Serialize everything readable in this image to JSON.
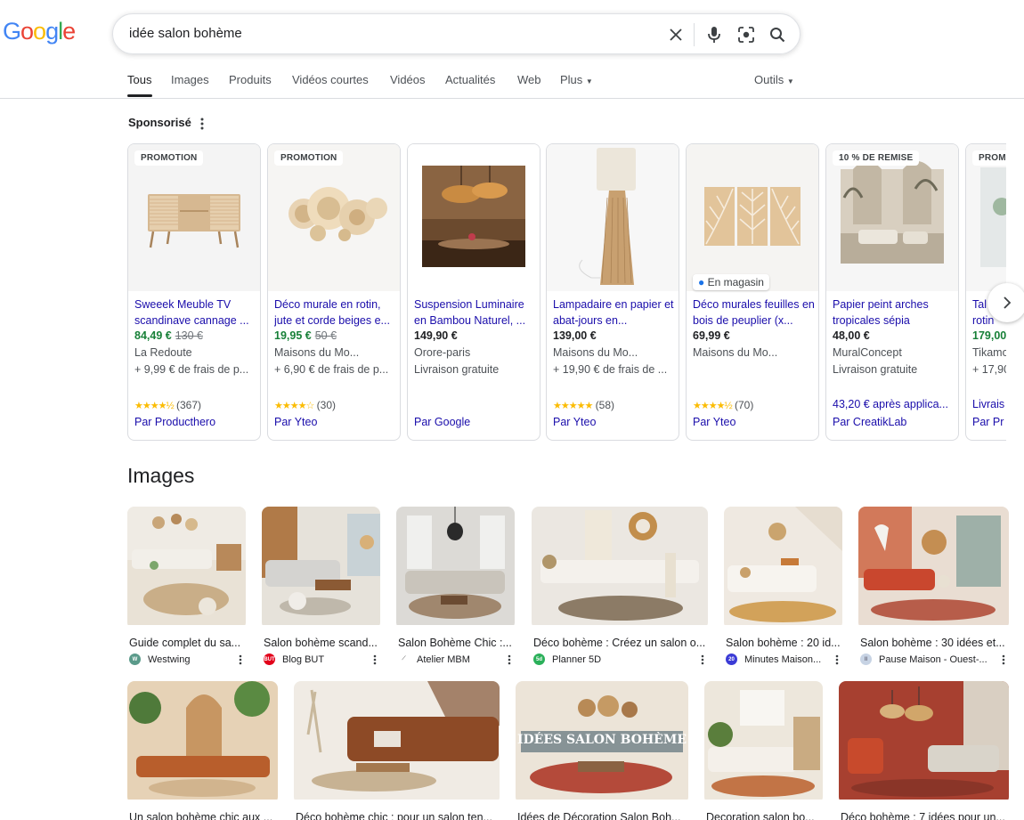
{
  "search": {
    "query": "idée salon bohème",
    "clear_label": "×"
  },
  "logo": {
    "letters": [
      "G",
      "o",
      "o",
      "g",
      "l",
      "e"
    ],
    "colors": [
      "#4285f4",
      "#ea4335",
      "#fbbc05",
      "#4285f4",
      "#34a853",
      "#ea4335"
    ]
  },
  "tabs": [
    "Tous",
    "Images",
    "Produits",
    "Vidéos courtes",
    "Vidéos",
    "Actualités",
    "Web",
    "Plus",
    "Outils"
  ],
  "sponsored": {
    "label": "Sponsorisé"
  },
  "cards": [
    {
      "badge": "PROMOTION",
      "title": "Sweeek Meuble TV scandinave cannage ...",
      "price": "84,49 €",
      "old_price": "130 €",
      "store": "La Redoute",
      "shipping": "+ 9,99 € de frais de p...",
      "rating": "(367)",
      "stars": "★★★★½",
      "by": "Par Producthero"
    },
    {
      "badge": "PROMOTION",
      "title": "Déco murale en rotin, jute et corde beiges e...",
      "price": "19,95 €",
      "old_price": "50 €",
      "store": "Maisons du Mo...",
      "shipping": "+ 6,90 € de frais de p...",
      "rating": "(30)",
      "stars": "★★★★☆",
      "by": "Par Yteo"
    },
    {
      "badge": "",
      "title": "Suspension Luminaire en Bambou Naturel, ...",
      "price": "149,90 €",
      "old_price": "",
      "store": "Orore-paris",
      "shipping": "Livraison gratuite",
      "rating": "",
      "stars": "",
      "by": "Par Google"
    },
    {
      "badge": "",
      "title": "Lampadaire en papier et abat-jours en...",
      "price": "139,00 €",
      "old_price": "",
      "store": "Maisons du Mo...",
      "shipping": "+ 19,90 € de frais de ...",
      "rating": "(58)",
      "stars": "★★★★★",
      "by": "Par Yteo"
    },
    {
      "badge": "",
      "store_tag": "En magasin",
      "title": "Déco murales feuilles en bois de peuplier (x...",
      "price": "69,99 €",
      "old_price": "",
      "store": "Maisons du Mo...",
      "shipping": "",
      "rating": "(70)",
      "stars": "★★★★½",
      "by": "Par Yteo"
    },
    {
      "badge": "10 % DE REMISE",
      "title": "Papier peint arches tropicales sépia",
      "price": "48,00 €",
      "old_price": "",
      "store": "MuralConcept",
      "shipping": "Livraison gratuite",
      "extra": "43,20 € après applica...",
      "rating": "",
      "stars": "",
      "by": "Par CreatikLab"
    },
    {
      "badge": "PROM",
      "title": "Tal rotin",
      "price": "179,00",
      "old_price": "",
      "store": "Tikamo",
      "shipping": "+ 17,90",
      "extra": "Livrais",
      "rating": "",
      "stars": "",
      "by": "Par Pr"
    }
  ],
  "images_section": {
    "title": "Images"
  },
  "images_row1": [
    {
      "caption": "Guide complet du sa...",
      "source": "Westwing",
      "fav": "W",
      "fav_color": "#5a9a8a"
    },
    {
      "caption": "Salon bohème scand...",
      "source": "Blog BUT",
      "fav": "BUT",
      "fav_color": "#e2001a"
    },
    {
      "caption": "Salon Bohème Chic :...",
      "source": "Atelier MBM",
      "fav": "",
      "fav_color": "#ffffff"
    },
    {
      "caption": "Déco bohème : Créez un salon o...",
      "source": "Planner 5D",
      "fav": "5d",
      "fav_color": "#2bb05a"
    },
    {
      "caption": "Salon bohème : 20 id...",
      "source": "Minutes Maison...",
      "fav": "20",
      "fav_color": "#3b3bd6"
    },
    {
      "caption": "Salon bohème : 30 idées et...",
      "source": "Pause Maison - Ouest-...",
      "fav": "ll",
      "fav_color": "#c7d3e4"
    }
  ],
  "images_row2": [
    {
      "caption": "Un salon bohème chic aux ..."
    },
    {
      "caption": "Déco bohème chic : pour un salon ten..."
    },
    {
      "caption": "Idées de Décoration Salon Boh..."
    },
    {
      "caption": "Decoration salon bo..."
    },
    {
      "caption": "Déco bohème : 7 idées pour un..."
    }
  ],
  "image_overlay_text": "IDÉES SALON BOHÈME"
}
